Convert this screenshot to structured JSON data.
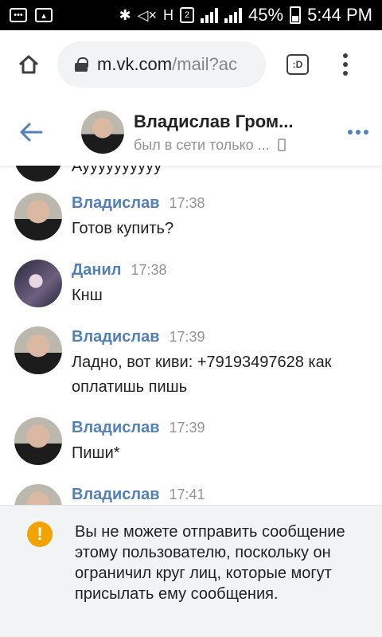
{
  "status_bar": {
    "battery_percent": "45%",
    "time": "5:44 PM",
    "network_label": "H",
    "sim_label": "2"
  },
  "browser": {
    "url_domain": "m.vk.com",
    "url_path": "/mail?ac",
    "tab_label": ":D"
  },
  "chat_header": {
    "name": "Владислав Гром...",
    "status": "был в сети только ..."
  },
  "messages": [
    {
      "author": "",
      "time": "",
      "text": "Ауууууууууу"
    },
    {
      "author": "Владислав",
      "time": "17:38",
      "text": "Готов купить?"
    },
    {
      "author": "Данил",
      "time": "17:38",
      "text": "Кнш"
    },
    {
      "author": "Владислав",
      "time": "17:39",
      "text": "Ладно, вот киви: +79193497628 как оплатишь пишь"
    },
    {
      "author": "Владислав",
      "time": "17:39",
      "text": "Пиши*"
    },
    {
      "author": "Владислав",
      "time": "17:41",
      "text": ""
    }
  ],
  "notice": {
    "icon": "!",
    "text": "Вы не можете отправить сообщение этому пользователю, поскольку он ограничил круг лиц, которые могут присылать ему сообщения."
  },
  "colors": {
    "accent": "#5181b8",
    "warning": "#f2a300"
  },
  "icons": {
    "status_left": [
      "message-icon",
      "image-icon"
    ],
    "status_right": [
      "bluetooth-icon",
      "mute-icon",
      "signal-icon",
      "battery-icon"
    ],
    "browser": [
      "home-icon",
      "lock-icon",
      "tab-switcher-icon",
      "overflow-menu-icon"
    ],
    "chat": [
      "back-arrow-icon",
      "more-dots-icon",
      "phone-icon",
      "warning-icon"
    ]
  }
}
